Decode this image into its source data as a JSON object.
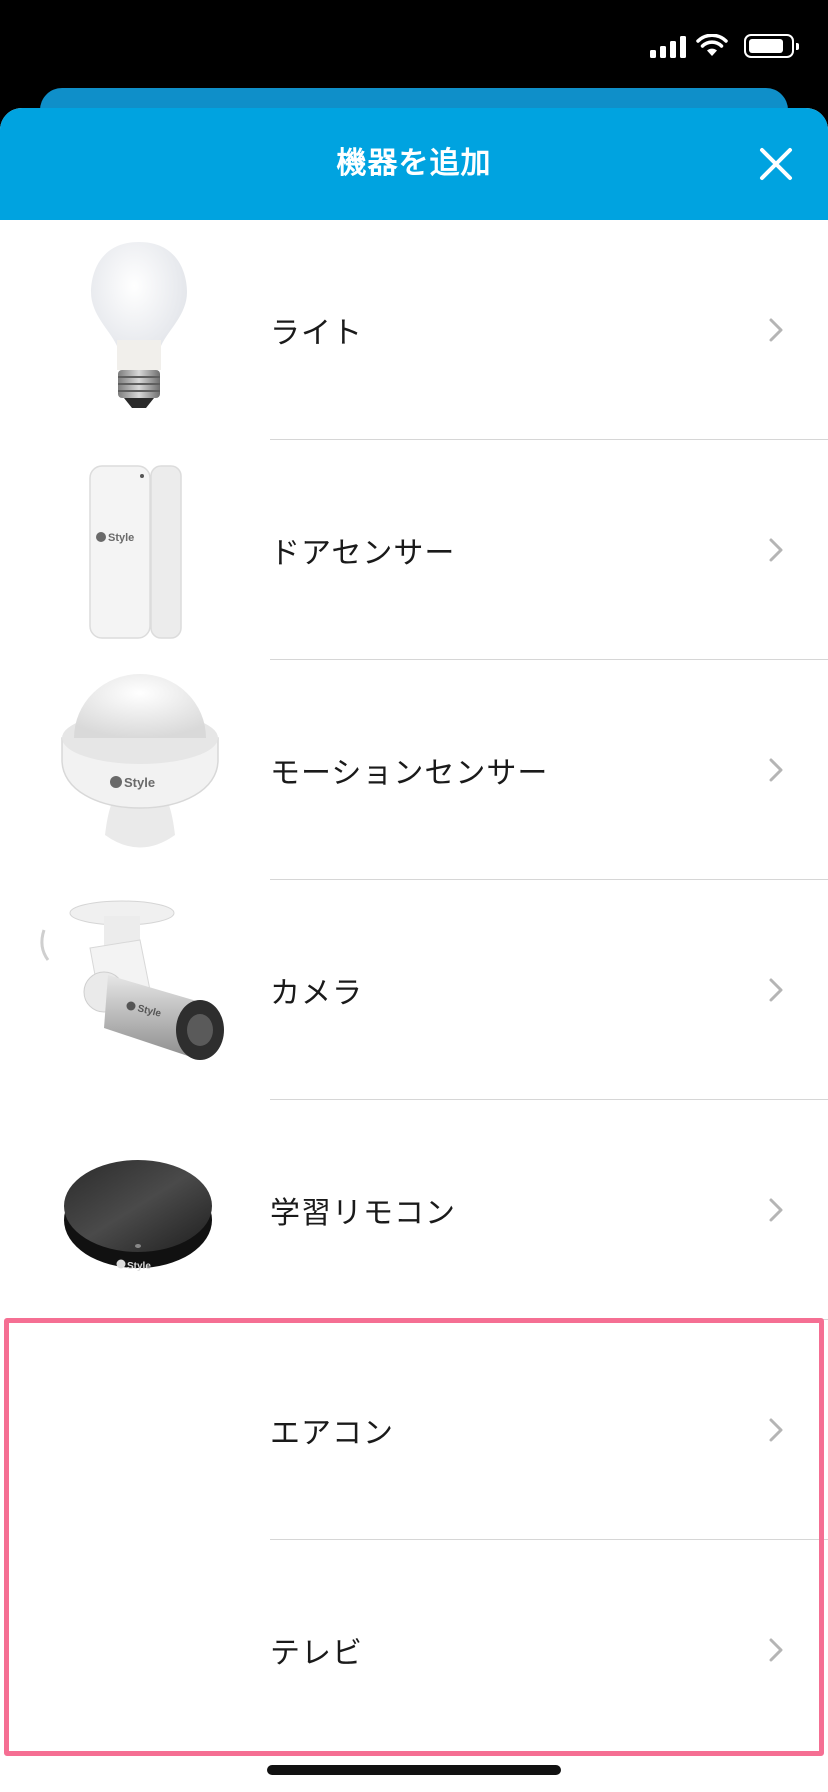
{
  "status_bar": {
    "signal_icon": "cellular-signal-icon",
    "wifi_icon": "wifi-icon",
    "battery_icon": "battery-icon"
  },
  "header": {
    "title": "機器を追加",
    "close_icon": "close-icon",
    "background_color": "#00a3e0"
  },
  "devices": [
    {
      "label": "ライト",
      "icon": "light-bulb-image",
      "chevron": "chevron-right-icon"
    },
    {
      "label": "ドアセンサー",
      "icon": "door-sensor-image",
      "chevron": "chevron-right-icon",
      "brand_text": "Style"
    },
    {
      "label": "モーションセンサー",
      "icon": "motion-sensor-image",
      "chevron": "chevron-right-icon",
      "brand_text": "Style"
    },
    {
      "label": "カメラ",
      "icon": "camera-image",
      "chevron": "chevron-right-icon",
      "brand_text": "Style"
    },
    {
      "label": "学習リモコン",
      "icon": "remote-hub-image",
      "chevron": "chevron-right-icon",
      "brand_text": "Style"
    },
    {
      "label": "エアコン",
      "icon": "",
      "chevron": "chevron-right-icon"
    },
    {
      "label": "テレビ",
      "icon": "",
      "chevron": "chevron-right-icon"
    }
  ],
  "highlight_color": "#f56f93"
}
